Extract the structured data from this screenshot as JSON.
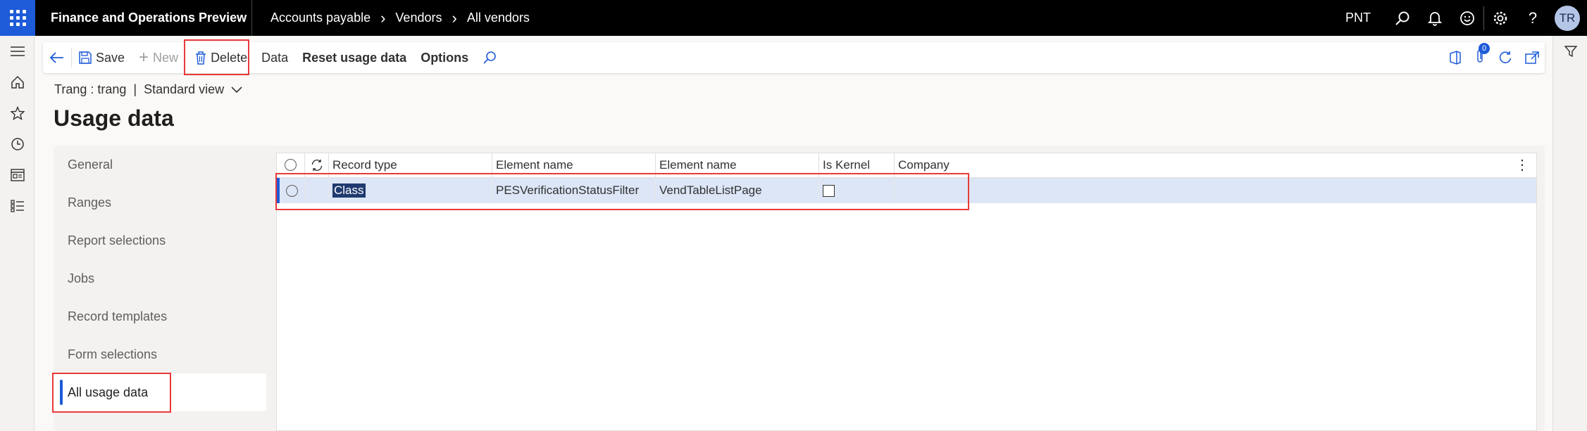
{
  "topbar": {
    "app_title": "Finance and Operations Preview",
    "breadcrumb": [
      "Accounts payable",
      "Vendors",
      "All vendors"
    ],
    "company": "PNT",
    "avatar_initials": "TR"
  },
  "toolbar": {
    "save_label": "Save",
    "new_label": "New",
    "delete_label": "Delete",
    "data_label": "Data",
    "reset_label": "Reset usage data",
    "options_label": "Options",
    "attachments_count": "0"
  },
  "view": {
    "user": "Trang : trang",
    "separator": "|",
    "view_name": "Standard view"
  },
  "page": {
    "title": "Usage data"
  },
  "tabs": [
    {
      "label": "General"
    },
    {
      "label": "Ranges"
    },
    {
      "label": "Report selections"
    },
    {
      "label": "Jobs"
    },
    {
      "label": "Record templates"
    },
    {
      "label": "Form selections"
    },
    {
      "label": "All usage data"
    }
  ],
  "grid": {
    "columns": [
      "Record type",
      "Element name",
      "Element name",
      "Is Kernel",
      "Company"
    ],
    "rows": [
      {
        "record_type": "Class",
        "element_name_1": "PESVerificationStatusFilter",
        "element_name_2": "VendTableListPage",
        "is_kernel": false,
        "company": ""
      }
    ]
  },
  "colors": {
    "accent": "#1e5bd8",
    "highlight": "#e83a3a",
    "selected_row": "#dce6f7"
  }
}
